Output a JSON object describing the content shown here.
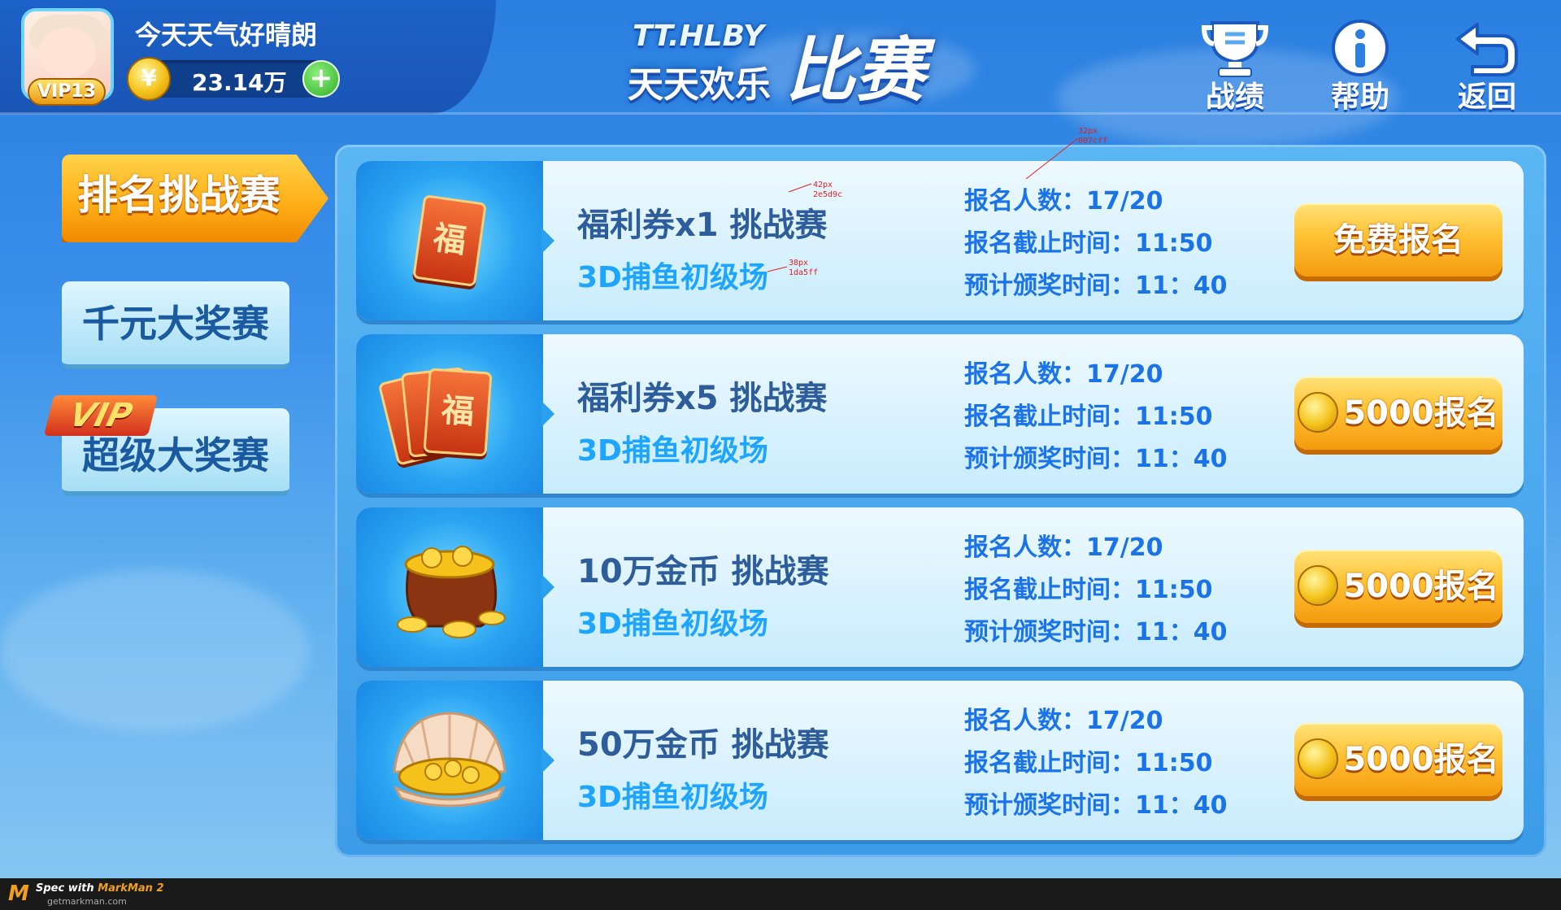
{
  "player": {
    "nickname": "今天天气好晴朗",
    "vip": "VIP13",
    "coins": "23.14万",
    "add_label": "+"
  },
  "logo": {
    "line1": "TT.HLBY",
    "line2": "天天欢乐",
    "line3": "比赛"
  },
  "top_buttons": {
    "record": "战绩",
    "help": "帮助",
    "back": "返回"
  },
  "tabs": {
    "ranking": "排名挑战赛",
    "thousand": "千元大奖赛",
    "vip_ribbon": "VIP",
    "super": "超级大奖赛"
  },
  "matches": [
    {
      "title": "福利券x1 挑战赛",
      "subtitle": "3D捕鱼初级场",
      "signup_count": "报名人数：17/20",
      "deadline": "报名截止时间：11:50",
      "award_time": "预计颁奖时间：11：40",
      "button": "免费报名",
      "icon": "ticket-single-icon",
      "ticket_char": "福"
    },
    {
      "title": "福利券x5 挑战赛",
      "subtitle": "3D捕鱼初级场",
      "signup_count": "报名人数：17/20",
      "deadline": "报名截止时间：11:50",
      "award_time": "预计颁奖时间：11：40",
      "button": "5000报名",
      "icon": "ticket-stack-icon",
      "ticket_char": "福"
    },
    {
      "title": "10万金币 挑战赛",
      "subtitle": "3D捕鱼初级场",
      "signup_count": "报名人数：17/20",
      "deadline": "报名截止时间：11:50",
      "award_time": "预计颁奖时间：11：40",
      "button": "5000报名",
      "icon": "coin-bag-icon"
    },
    {
      "title": "50万金币 挑战赛",
      "subtitle": "3D捕鱼初级场",
      "signup_count": "报名人数：17/20",
      "deadline": "报名截止时间：11:50",
      "award_time": "预计颁奖时间：11：40",
      "button": "5000报名",
      "icon": "coin-shell-icon"
    }
  ],
  "spec_annotations": {
    "a1_size": "32px",
    "a1_color": "007cff",
    "a2_size": "42px",
    "a2_color": "2e5d9c",
    "a3_size": "38px",
    "a3_color": "1da5ff"
  },
  "footer": {
    "logo_mark": "M",
    "spec_prefix": "Spec with",
    "spec_app": "MarkMan 2",
    "url": "getmarkman.com"
  },
  "colors": {
    "title": "#2e5d9c",
    "subtitle": "#1da5ff",
    "info": "#1a73e8",
    "accent_orange": "#ffb018"
  }
}
